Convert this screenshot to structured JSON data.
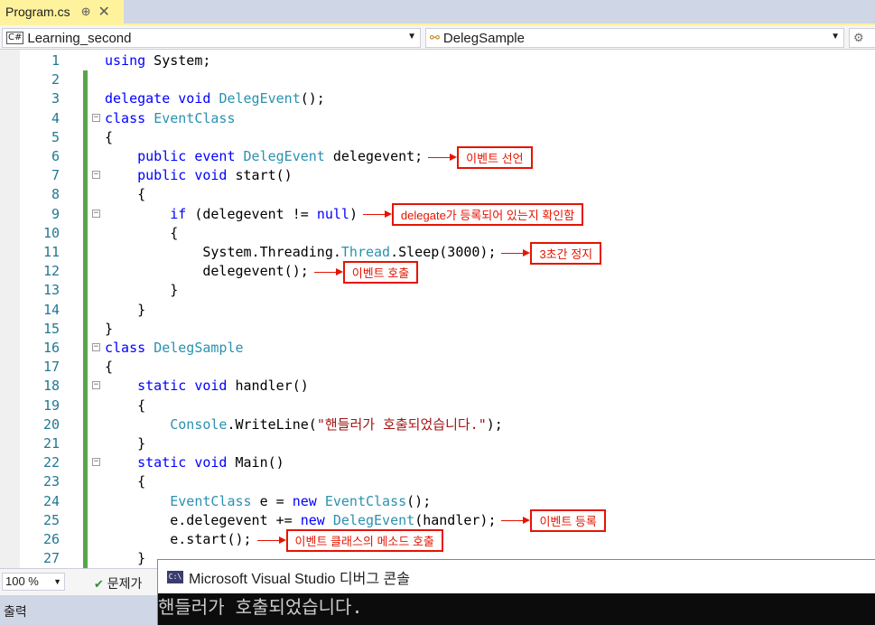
{
  "tab": {
    "title": "Program.cs",
    "pin": "⊕",
    "close": "✕"
  },
  "navigation": {
    "project": "Learning_second",
    "project_icon": "C#",
    "class": "DelegSample",
    "member_icon": "⚙"
  },
  "code_lines": [
    "using System;",
    "",
    "delegate void DelegEvent();",
    "class EventClass",
    "{",
    "    public event DelegEvent delegevent;",
    "    public void start()",
    "    {",
    "        if (delegevent != null)",
    "        {",
    "            System.Threading.Thread.Sleep(3000);",
    "            delegevent();",
    "        }",
    "    }",
    "}",
    "class DelegSample",
    "{",
    "    static void handler()",
    "    {",
    "        Console.WriteLine(\"핸들러가 호출되었습니다.\");",
    "    }",
    "    static void Main()",
    "    {",
    "        EventClass e = new EventClass();",
    "        e.delegevent += new DelegEvent(handler);",
    "        e.start();",
    "    }"
  ],
  "annotations": [
    {
      "line": 6,
      "text": "이벤트 선언"
    },
    {
      "line": 9,
      "text": "delegate가 등록되어 있는지 확인함"
    },
    {
      "line": 11,
      "text": "3초간 정지"
    },
    {
      "line": 12,
      "text": "이벤트 호출"
    },
    {
      "line": 25,
      "text": "이벤트 등록"
    },
    {
      "line": 26,
      "text": "이벤트 클래스의 메소드 호출"
    }
  ],
  "status": {
    "zoom": "100 %",
    "problems": "문제가",
    "output_tab": "출력"
  },
  "console": {
    "title": "Microsoft Visual Studio 디버그 콘솔",
    "icon": "C:\\",
    "output": "핸들러가 호출되었습니다."
  },
  "colors": {
    "keyword": "#0000ff",
    "type": "#2b91af",
    "string": "#a31515",
    "annotation": "#e51400",
    "change_bar": "#57a64a",
    "tab_active": "#fff29d"
  }
}
